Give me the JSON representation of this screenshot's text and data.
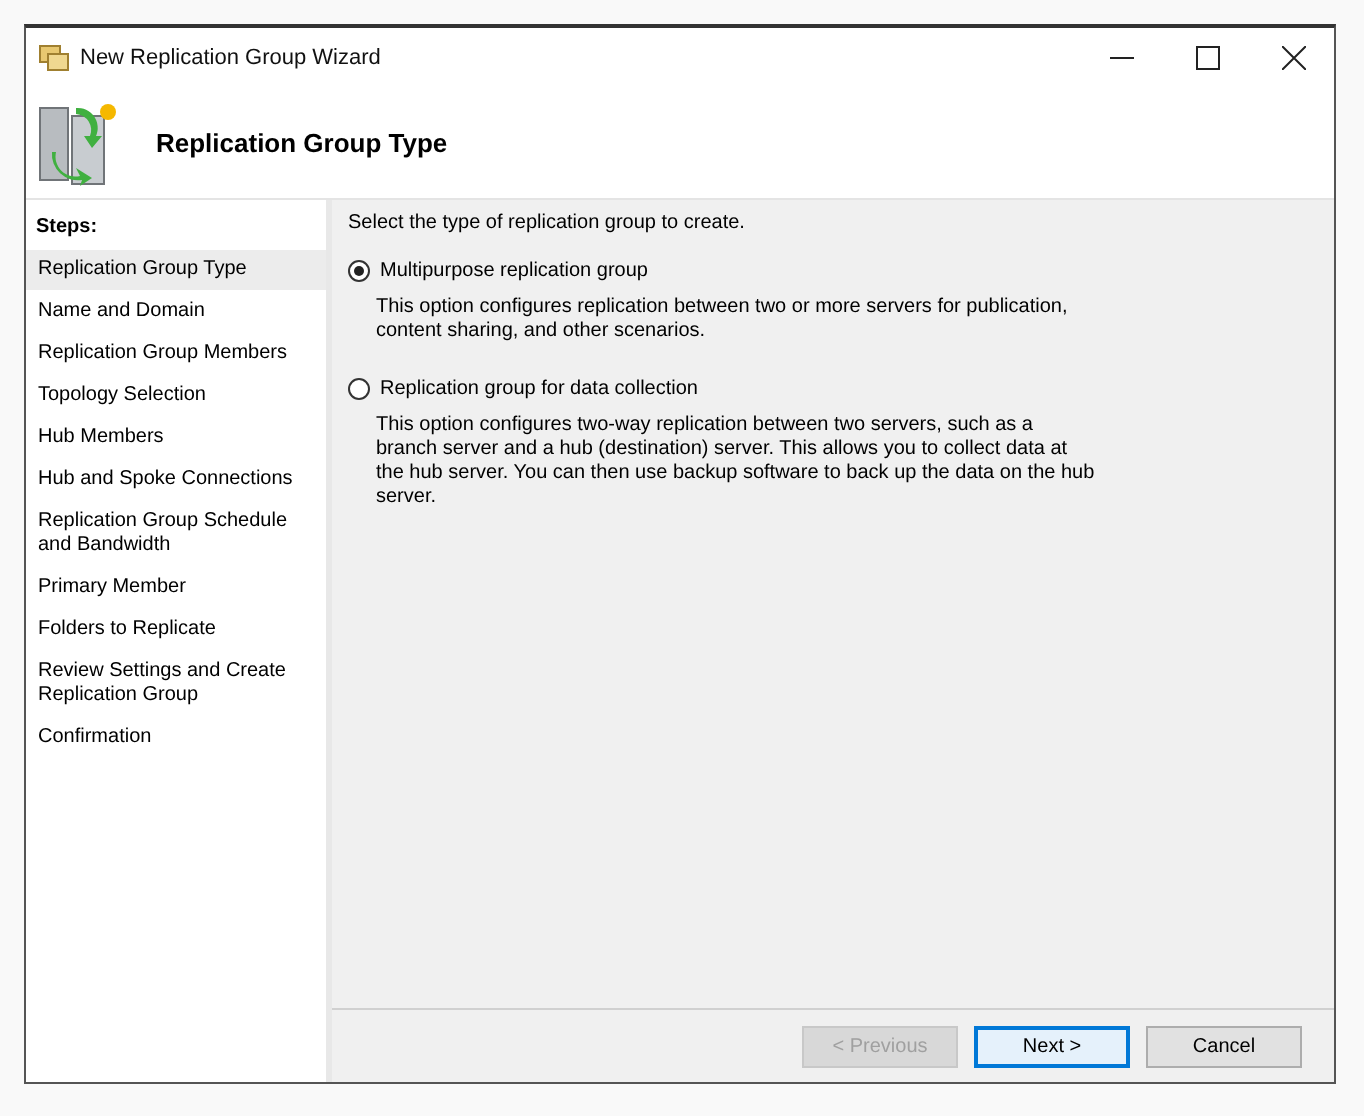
{
  "window": {
    "title": "New Replication Group Wizard"
  },
  "header": {
    "title": "Replication Group Type"
  },
  "sidebar": {
    "heading": "Steps:",
    "items": [
      {
        "label": "Replication Group Type",
        "selected": true
      },
      {
        "label": "Name and Domain",
        "selected": false
      },
      {
        "label": "Replication Group Members",
        "selected": false
      },
      {
        "label": "Topology Selection",
        "selected": false
      },
      {
        "label": "Hub Members",
        "selected": false
      },
      {
        "label": "Hub and Spoke Connections",
        "selected": false
      },
      {
        "label": "Replication Group Schedule and Bandwidth",
        "selected": false
      },
      {
        "label": "Primary Member",
        "selected": false
      },
      {
        "label": "Folders to Replicate",
        "selected": false
      },
      {
        "label": "Review Settings and Create Replication Group",
        "selected": false
      },
      {
        "label": "Confirmation",
        "selected": false
      }
    ]
  },
  "prompt": "Select the type of replication group to create.",
  "options": [
    {
      "label": "Multipurpose replication group",
      "selected": true,
      "description": "This option configures replication between two or more servers for publication, content sharing, and other scenarios."
    },
    {
      "label": "Replication group for data collection",
      "selected": false,
      "description": "This option configures two-way replication between two servers, such as a branch server and a hub (destination) server. This allows you to collect data at the hub server. You can then use backup software to back up the data on the hub server."
    }
  ],
  "buttons": [
    {
      "label": "< Previous",
      "disabled": true,
      "default": false
    },
    {
      "label": "Next >",
      "disabled": false,
      "default": true
    },
    {
      "label": "Cancel",
      "disabled": false,
      "default": false
    }
  ]
}
